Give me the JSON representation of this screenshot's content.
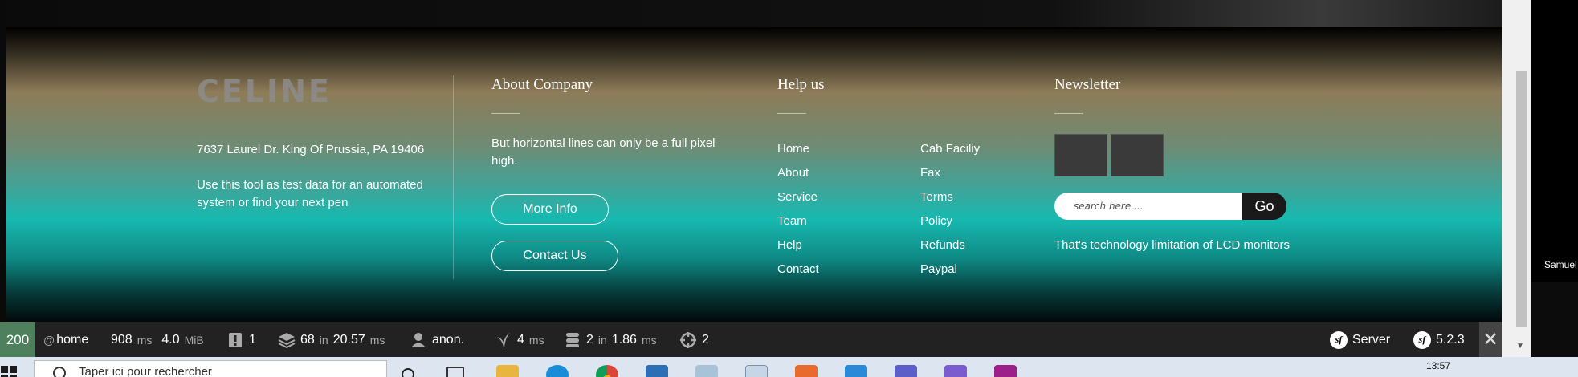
{
  "footer": {
    "logo": "CELINE",
    "address": "7637 Laurel Dr. King Of Prussia, PA 19406",
    "description": "Use this tool as test data for an automated system or find your next pen",
    "about": {
      "title": "About Company",
      "text": "But horizontal lines can only be a full pixel high.",
      "more_info": "More Info",
      "contact_us": "Contact Us"
    },
    "help": {
      "title": "Help us",
      "col1": [
        "Home",
        "About",
        "Service",
        "Team",
        "Help",
        "Contact"
      ],
      "col2": [
        "Cab Faciliy",
        "Fax",
        "Terms",
        "Policy",
        "Refunds",
        "Paypal"
      ]
    },
    "newsletter": {
      "title": "Newsletter",
      "search_placeholder": "search here....",
      "go_label": "Go",
      "text": "That's technology limitation of LCD monitors"
    }
  },
  "right_panel": {
    "name": "Samuel"
  },
  "toolbar": {
    "status": "200",
    "route_prefix": "@",
    "route": "home",
    "time": "908",
    "time_unit": "ms",
    "memory": "4.0",
    "memory_unit": "MiB",
    "logs": "1",
    "cache_count": "68",
    "cache_in": "in",
    "cache_time": "20.57",
    "cache_unit": "ms",
    "user": "anon.",
    "twig_time": "4",
    "twig_unit": "ms",
    "db_count": "2",
    "db_in": "in",
    "db_time": "1.86",
    "db_unit": "ms",
    "events": "2",
    "server_label": "Server",
    "version": "5.2.3",
    "close_glyph": "✕"
  },
  "taskbar": {
    "search_placeholder": "Taper ici pour rechercher",
    "time": "13:57"
  },
  "colors": {
    "status_green": "#4f805d",
    "toolbar_bg": "#222222",
    "teal": "#17b9b0"
  }
}
